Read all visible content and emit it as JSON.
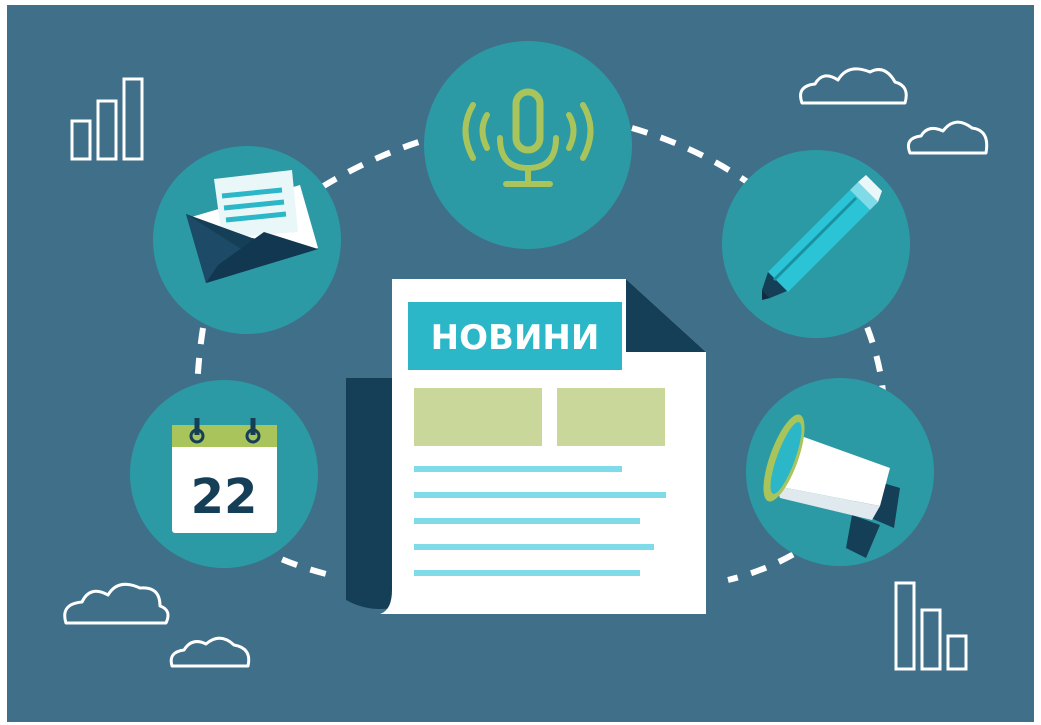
{
  "newspaper": {
    "headline": "НОВИНИ"
  },
  "calendar": {
    "day": "22"
  },
  "icons": [
    "microphone-icon",
    "envelope-icon",
    "pencil-icon",
    "calendar-icon",
    "megaphone-icon",
    "newspaper-icon",
    "cloud-icon",
    "bar-chart-icon"
  ],
  "colors": {
    "background": "#3f6f89",
    "circle": "#2b9aa4",
    "accent_cyan": "#2bb7c7",
    "accent_green": "#a9c45a",
    "navy": "#153e57",
    "paper": "#ffffff",
    "line_cyan": "#7fdbe8",
    "block_green": "#c9d79a"
  }
}
